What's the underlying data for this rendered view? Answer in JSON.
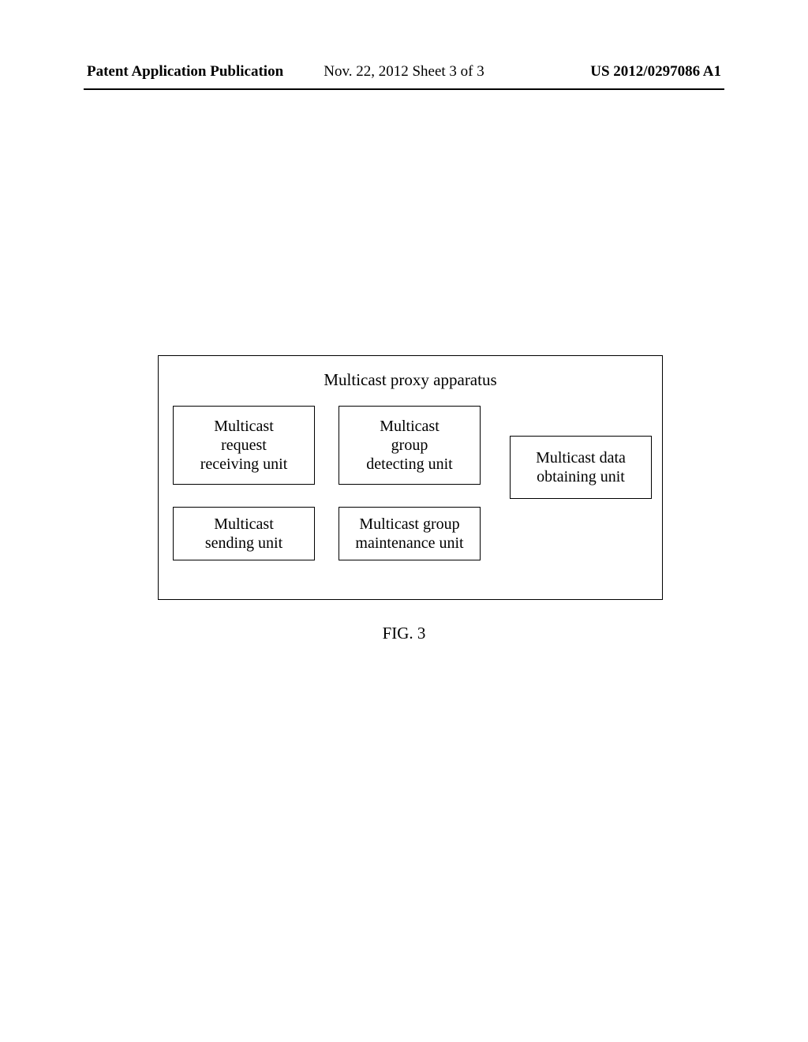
{
  "header": {
    "left": "Patent Application Publication",
    "center": "Nov. 22, 2012  Sheet 3 of 3",
    "right": "US 2012/0297086 A1"
  },
  "diagram": {
    "title": "Multicast proxy apparatus",
    "boxes": {
      "request_receiving": {
        "line1": "Multicast",
        "line2": "request",
        "line3": "receiving unit"
      },
      "group_detecting": {
        "line1": "Multicast",
        "line2": "group",
        "line3": "detecting unit"
      },
      "data_obtaining": {
        "line1": "Multicast data",
        "line2": "obtaining unit"
      },
      "sending": {
        "line1": "Multicast",
        "line2": "sending unit"
      },
      "group_maintenance": {
        "line1": "Multicast group",
        "line2": "maintenance unit"
      }
    }
  },
  "figure_label": "FIG. 3"
}
